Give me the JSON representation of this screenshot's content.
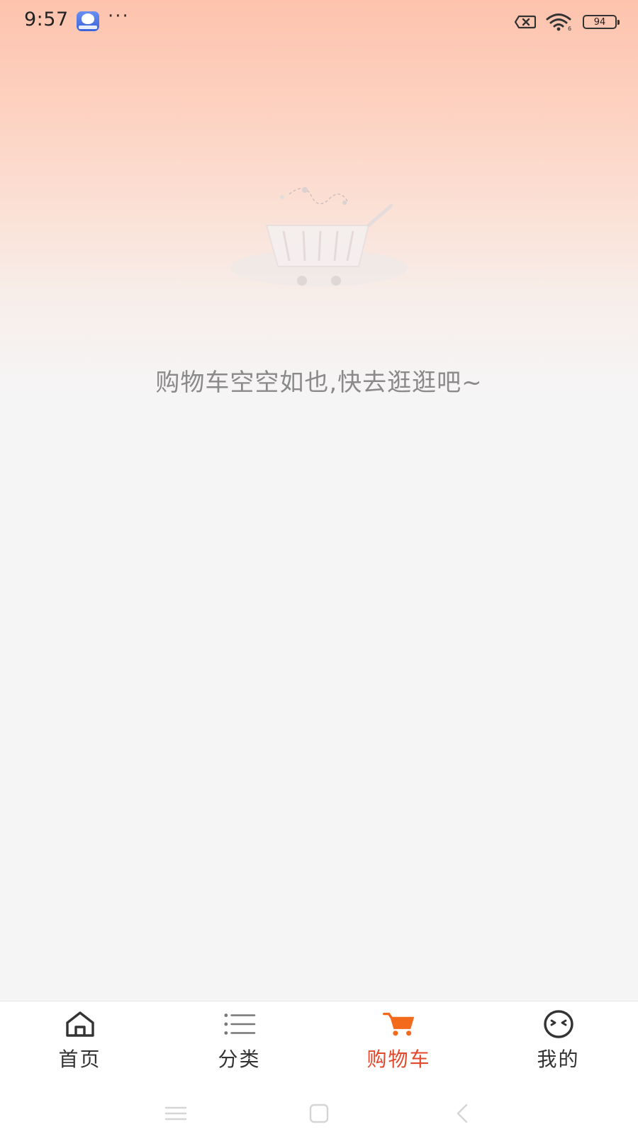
{
  "status_bar": {
    "time": "9:57",
    "more": "···",
    "battery_level": "94",
    "icons": [
      "baidu-app-icon",
      "sim-off-icon",
      "wifi-icon",
      "battery-icon"
    ]
  },
  "main": {
    "illustration": "shopping-cart-illustration",
    "empty_message": "购物车空空如也,快去逛逛吧~"
  },
  "tab_bar": {
    "active_color": "#e2492c",
    "items": [
      {
        "label": "首页",
        "icon": "home-icon"
      },
      {
        "label": "分类",
        "icon": "list-icon"
      },
      {
        "label": "购物车",
        "icon": "cart-icon",
        "active": true
      },
      {
        "label": "我的",
        "icon": "face-icon"
      }
    ]
  },
  "nav_bar": {
    "icons": [
      "menu-icon",
      "home-square-icon",
      "back-icon"
    ]
  }
}
